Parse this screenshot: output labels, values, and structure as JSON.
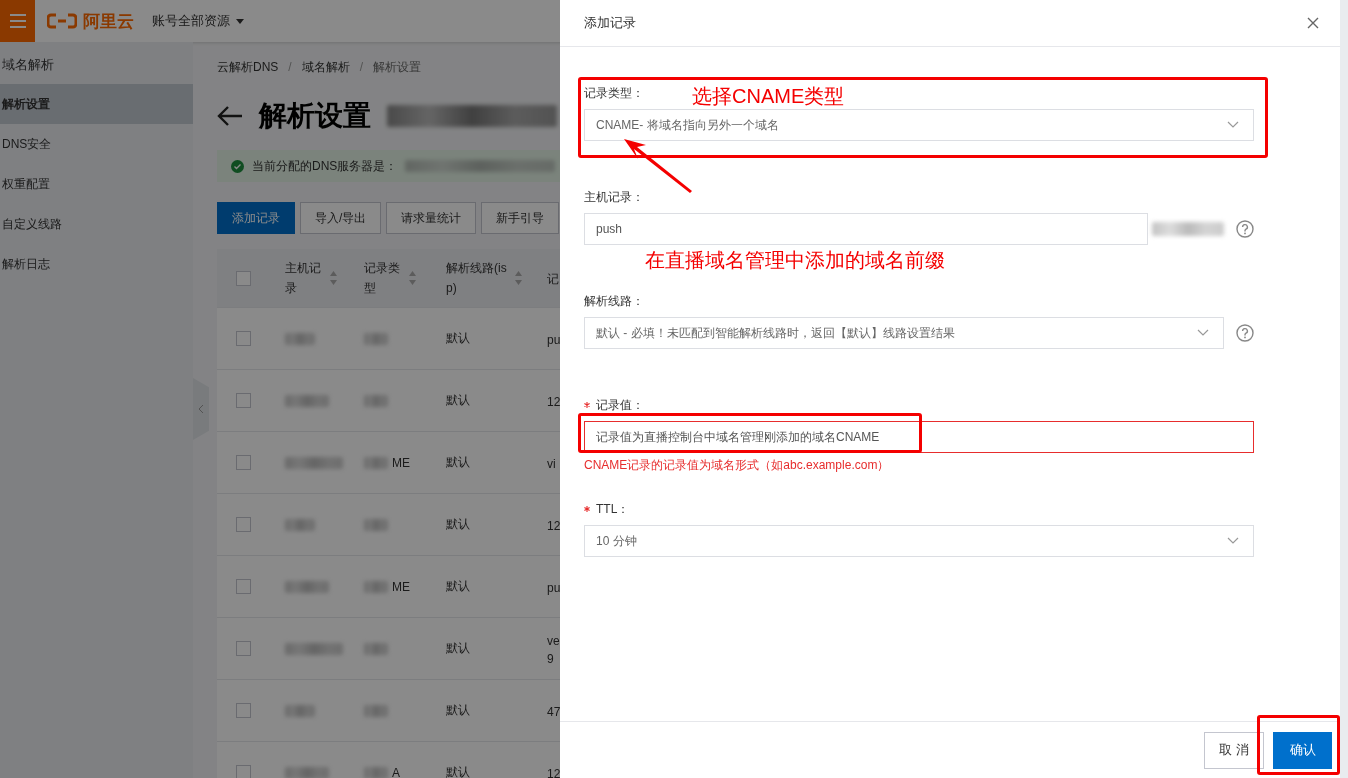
{
  "topbar": {
    "logo_text": "阿里云",
    "account_menu": "账号全部资源"
  },
  "sidebar": {
    "title": "域名解析",
    "items": [
      {
        "label": "解析设置",
        "selected": true
      },
      {
        "label": "DNS安全",
        "selected": false
      },
      {
        "label": "权重配置",
        "selected": false
      },
      {
        "label": "自定义线路",
        "selected": false
      },
      {
        "label": "解析日志",
        "selected": false
      }
    ]
  },
  "breadcrumb": [
    {
      "kind": "link",
      "text": "云解析DNS"
    },
    {
      "kind": "separator",
      "text": "/"
    },
    {
      "kind": "link",
      "text": "域名解析"
    },
    {
      "kind": "separator",
      "text": "/"
    },
    {
      "kind": "current",
      "text": "解析设置"
    }
  ],
  "page_title": "解析设置",
  "notice": "当前分配的DNS服务器是：",
  "toolbar_buttons": [
    {
      "label": "添加记录",
      "kind": "primary"
    },
    {
      "label": "导入/导出",
      "kind": "default"
    },
    {
      "label": "请求量统计",
      "kind": "default"
    },
    {
      "label": "新手引导",
      "kind": "default"
    }
  ],
  "table": {
    "all_checked": false,
    "columns": [
      "主机记录",
      "记录类型",
      "解析线路(isp)",
      "记"
    ],
    "rows": [
      {
        "checked": false,
        "type": "",
        "line": "默认",
        "column_4": "pu"
      },
      {
        "checked": false,
        "type": "",
        "line": "默认",
        "column_4": "12"
      },
      {
        "checked": false,
        "type": "ME",
        "line": "默认",
        "column_4": "vi"
      },
      {
        "checked": false,
        "type": "",
        "line": "默认",
        "column_4": "12"
      },
      {
        "checked": false,
        "type": "ME",
        "line": "默认",
        "column_4": "pu"
      },
      {
        "checked": false,
        "type": "",
        "line": "默认",
        "column_4": "ve\n9"
      },
      {
        "checked": false,
        "type": "",
        "line": "默认",
        "column_4": "47"
      },
      {
        "checked": false,
        "type": "A",
        "line": "默认",
        "column_4": "12"
      }
    ]
  },
  "dialog": {
    "title": "添加记录",
    "fields": [
      {
        "label": "记录类型：",
        "kind": "select",
        "value": "CNAME- 将域名指向另外一个域名",
        "highlighted": true,
        "annotation": "选择CNAME类型",
        "arrow": true
      },
      {
        "label": "主机记录：",
        "kind": "input",
        "value": "push",
        "help": true,
        "blurred_suffix": true,
        "annotation": "在直播域名管理中添加的域名前缀"
      },
      {
        "label": "解析线路：",
        "kind": "select",
        "value": "默认 - 必填！未匹配到智能解析线路时，返回【默认】线路设置结果",
        "help": true
      },
      {
        "label": "记录值：",
        "kind": "input",
        "value": "记录值为直播控制台中域名管理刚添加的域名CNAME",
        "required": true,
        "highlighted": true,
        "error": "CNAME记录的记录值为域名形式（如abc.example.com）"
      },
      {
        "label": "TTL：",
        "kind": "select",
        "value": "10 分钟",
        "required": true
      }
    ],
    "buttons": [
      {
        "label": "取 消",
        "kind": "default"
      },
      {
        "label": "确认",
        "kind": "primary",
        "highlighted": true
      }
    ]
  }
}
